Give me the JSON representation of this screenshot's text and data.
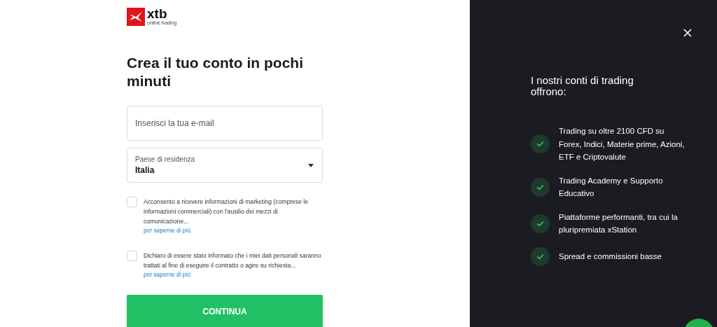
{
  "logo": {
    "name": "xtb",
    "tagline": "online trading"
  },
  "heading": "Crea il tuo conto in pochi minuti",
  "email": {
    "placeholder": "Inserisci la tua e-mail"
  },
  "country": {
    "label": "Paese di residenza",
    "value": "Italia"
  },
  "consents": [
    {
      "text": "Acconsento a ricevere informazioni di marketing (comprese le informazioni commerciali) con l'ausilio dei mezzi di comunicazione...",
      "link": "per saperne di più",
      "checked": false
    },
    {
      "text": "Dichiaro di essere stato informato che i miei dati personali saranno trattati al fine di eseguire il contratto o agire su richiesta...",
      "link": "per saperne di più",
      "checked": false
    }
  ],
  "submit": "CONTINUA",
  "panel": {
    "title": "I nostri conti di trading offrono:",
    "features": [
      "Trading su oltre 2100 CFD su Forex, Indici, Materie prime, Azioni, ETF e Criptovalute",
      "Trading Academy e Supporto Educativo",
      "Piattaforme performanti, tra cui la pluripremiata xStation",
      "Spread e commissioni basse"
    ]
  }
}
